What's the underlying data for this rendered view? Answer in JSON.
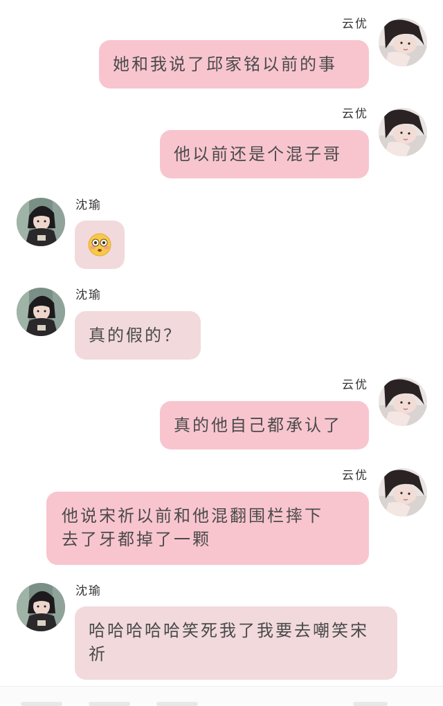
{
  "messages": [
    {
      "side": "right",
      "sender": "云优",
      "text": "她和我说了邱家铭以前的事"
    },
    {
      "side": "right",
      "sender": "云优",
      "text": "他以前还是个混子哥"
    },
    {
      "side": "left",
      "sender": "沈瑜",
      "emoji": "flushed-face-emoji"
    },
    {
      "side": "left",
      "sender": "沈瑜",
      "text": "真的假的？"
    },
    {
      "side": "right",
      "sender": "云优",
      "text": "真的他自己都承认了"
    },
    {
      "side": "right",
      "sender": "云优",
      "text": "他说宋祈以前和他混翻围栏摔下去了牙都掉了一颗"
    },
    {
      "side": "left",
      "sender": "沈瑜",
      "text": "哈哈哈哈哈笑死我了我要去嘲笑宋祈"
    }
  ],
  "colors": {
    "right_bubble": "#f8c5cf",
    "left_bubble": "#f1d9dc",
    "text": "#4a4a4a"
  }
}
